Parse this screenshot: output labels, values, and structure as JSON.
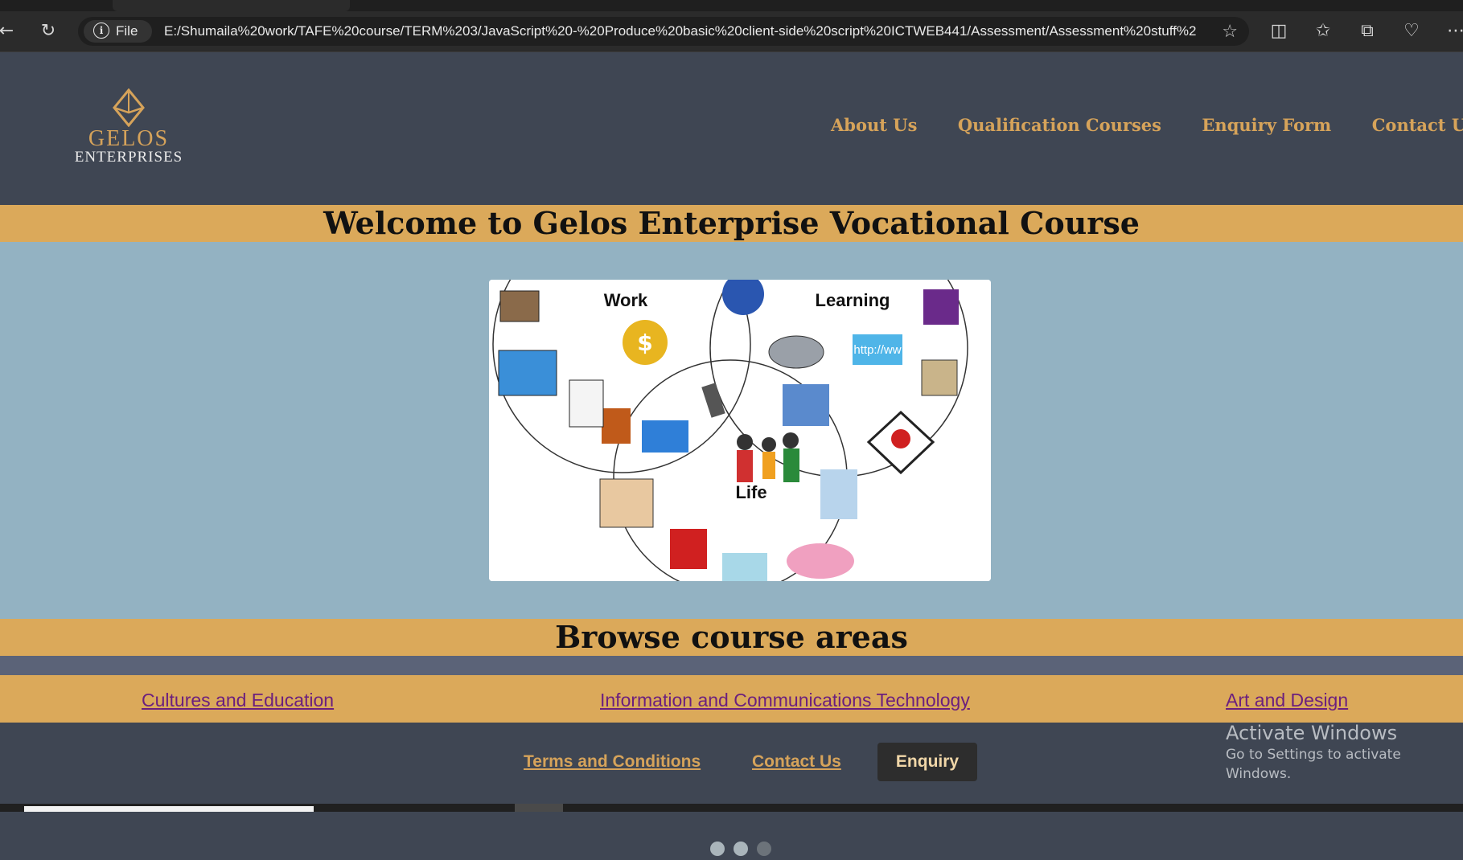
{
  "browser": {
    "address_chip": "File",
    "url": "E:/Shumaila%20work/TAFE%20course/TERM%203/JavaScript%20-%20Produce%20basic%20client-side%20script%20ICTWEB441/Assessment/Assessment%20stuff%2..."
  },
  "logo": {
    "line1": "GELOS",
    "line2": "ENTERPRISES"
  },
  "nav": {
    "about": "About Us",
    "courses": "Qualification Courses",
    "enquiry": "Enquiry Form",
    "contact": "Contact Us"
  },
  "welcome_title": "Welcome to Gelos Enterprise Vocational Course",
  "slide": {
    "label_work": "Work",
    "label_learning": "Learning",
    "label_life": "Life",
    "http_badge": "http://ww"
  },
  "carousel": {
    "slide_count": 3,
    "active_index": 2
  },
  "browse_title": "Browse course areas",
  "areas": {
    "a1": "Cultures and Education",
    "a2": "Information and Communications Technology",
    "a3": "Art and Design"
  },
  "footer": {
    "terms": "Terms and Conditions",
    "contact": "Contact Us",
    "enquiry": "Enquiry"
  },
  "activate": {
    "title": "Activate Windows",
    "subtitle": "Go to Settings to activate Windows."
  },
  "colors": {
    "header_bg": "#3f4653",
    "accent_gold": "#dba95a",
    "hero_bg": "#93b2c2",
    "link_purple": "#6b1f7e"
  }
}
